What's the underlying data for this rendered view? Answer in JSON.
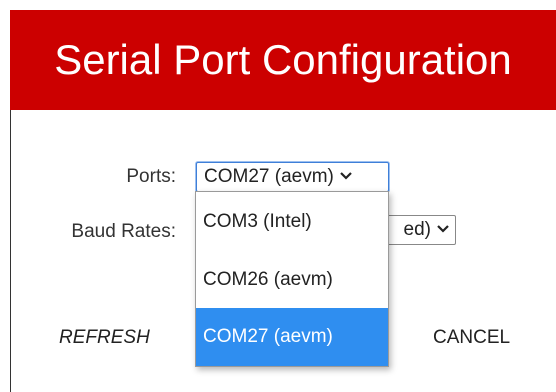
{
  "header": {
    "title": "Serial Port Configuration"
  },
  "form": {
    "ports_label": "Ports:",
    "ports_selected": "COM27 (aevm)",
    "baud_label": "Baud Rates:",
    "baud_visible_fragment": "ed)"
  },
  "dropdown": {
    "options": [
      "COM3 (Intel)",
      "COM26 (aevm)",
      "COM27 (aevm)"
    ],
    "highlighted": "COM27 (aevm)"
  },
  "buttons": {
    "refresh": "REFRESH",
    "cancel": "CANCEL"
  },
  "colors": {
    "header_bg": "#cc0000",
    "highlight": "#2f8ef0",
    "focus_border": "#3f7fd8"
  },
  "icons": {
    "select_arrow": "chevron-down-icon"
  }
}
